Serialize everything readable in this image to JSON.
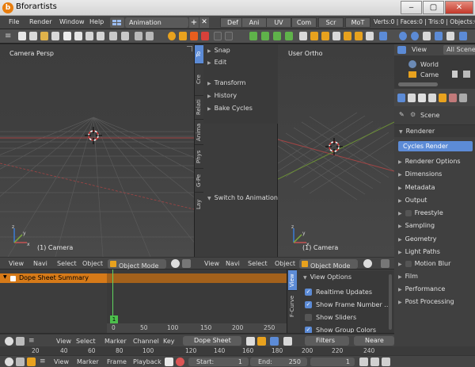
{
  "window": {
    "title": "Bforartists"
  },
  "window_buttons": {
    "min": "‒",
    "max": "▢",
    "close": "✕"
  },
  "menubar": {
    "items": [
      "File",
      "Render",
      "Window",
      "Help"
    ],
    "screen_layout": "Animation",
    "tabs": [
      "Def",
      "Ani",
      "UV",
      "Com",
      "Scr",
      "MoT"
    ],
    "stats": "Verts:0 | Faces:0 | Tris:0 | Objects:0/3"
  },
  "viewport_left": {
    "label": "Camera Persp",
    "object": "(1) Camera"
  },
  "viewport_right": {
    "label": "User Ortho",
    "object": "(1) Camera"
  },
  "tool_shelf": {
    "tabs": [
      "To",
      "Cre",
      "Relati",
      "Anima",
      "Phys",
      "G-Pe",
      "Lay"
    ],
    "panels": [
      "Snap",
      "Edit",
      "Transform",
      "History",
      "Bake Cycles"
    ],
    "last_operator": "Switch to Animation Lay"
  },
  "vp_header": {
    "view": "View",
    "navi": "Navi",
    "select": "Select",
    "object": "Object",
    "mode": "Object Mode"
  },
  "outliner": {
    "view": "View",
    "scope": "All Scene",
    "items": [
      "World",
      "Came"
    ]
  },
  "properties": {
    "context": "Scene",
    "renderer_header": "Renderer",
    "engine": "Cycles Render",
    "panels": [
      "Renderer Options",
      "Dimensions",
      "Metadata",
      "Output",
      "Freestyle",
      "Sampling",
      "Geometry",
      "Light Paths",
      "Motion Blur",
      "Film",
      "Performance",
      "Post Processing"
    ]
  },
  "dopesheet": {
    "summary": "Dope Sheet Summary",
    "current_frame": "1",
    "ruler": [
      "0",
      "50",
      "100",
      "150",
      "200",
      "250"
    ],
    "side_tabs": [
      "View",
      "F-Curve"
    ],
    "view_options_title": "View Options",
    "options": [
      {
        "label": "Realtime Updates",
        "checked": true
      },
      {
        "label": "Show Frame Number ...",
        "checked": true
      },
      {
        "label": "Show Sliders",
        "checked": false
      },
      {
        "label": "Show Group Colors",
        "checked": true
      }
    ]
  },
  "dope_header": {
    "view": "View",
    "select": "Select",
    "marker": "Marker",
    "channel": "Channel",
    "key": "Key",
    "mode": "Dope Sheet",
    "filters": "Filters",
    "nearest": "Neare"
  },
  "timeline_ruler": [
    "20",
    "40",
    "60",
    "80",
    "100",
    "120",
    "140",
    "160",
    "180",
    "200",
    "220",
    "240"
  ],
  "timeline_header": {
    "view": "View",
    "marker": "Marker",
    "frame": "Frame",
    "playback": "Playback",
    "start_label": "Start:",
    "start": "1",
    "end_label": "End:",
    "end": "250",
    "current": "1"
  },
  "colors": {
    "accent": "#e87d0d",
    "summary_bar": "#d67a18",
    "playhead": "#5fd45f",
    "selected_blue": "#5c8bd6",
    "axis_red": "#c65353",
    "axis_green": "#7cab3b"
  }
}
